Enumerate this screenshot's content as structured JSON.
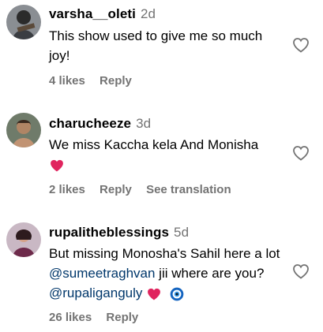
{
  "comments": [
    {
      "username": "varsha__oleti",
      "time": "2d",
      "text": "This show used to give me so much joy!",
      "likes": "4 likes",
      "reply": "Reply"
    },
    {
      "username": "charucheeze",
      "time": "3d",
      "text": "We miss Kaccha kela And Monisha",
      "likes": "2 likes",
      "reply": "Reply",
      "translate": "See translation"
    },
    {
      "username": "rupalitheblessings",
      "time": "5d",
      "text_start": "But missing Monosha's Sahil here a lot ",
      "mention1": "@sumeetraghvan",
      "text_mid": " jii where are you? ",
      "mention2": "@rupaliganguly",
      "likes": "26 likes",
      "reply": "Reply"
    }
  ],
  "icons": [
    "heart-outline-icon",
    "red-heart-emoji",
    "nazar-eye-emoji"
  ],
  "colors": {
    "mention": "#00376b",
    "meta": "#737373",
    "heart_emoji": "#e0245e"
  }
}
